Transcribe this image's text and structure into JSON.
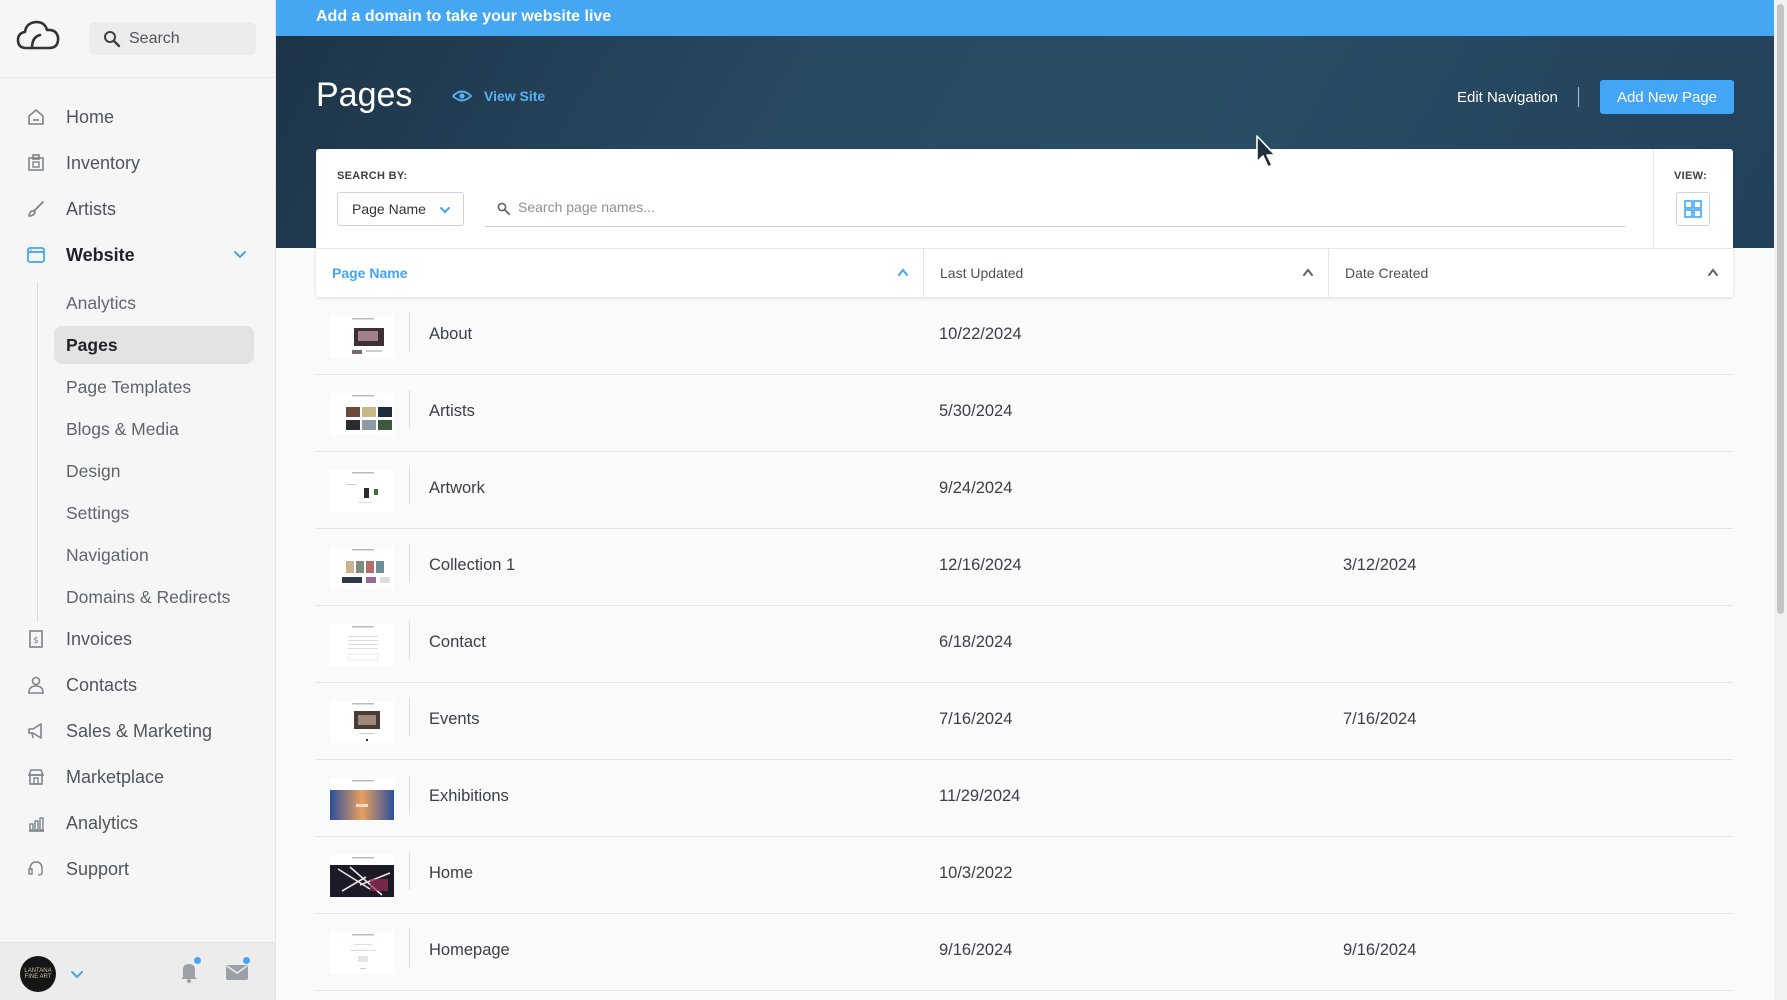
{
  "sidebar": {
    "search_label": "Search",
    "nav": [
      {
        "label": "Home",
        "icon": "home-icon"
      },
      {
        "label": "Inventory",
        "icon": "inventory-icon"
      },
      {
        "label": "Artists",
        "icon": "brush-icon"
      },
      {
        "label": "Website",
        "icon": "website-icon"
      }
    ],
    "website_sub": [
      {
        "label": "Analytics"
      },
      {
        "label": "Pages"
      },
      {
        "label": "Page Templates"
      },
      {
        "label": "Blogs & Media"
      },
      {
        "label": "Design"
      },
      {
        "label": "Settings"
      },
      {
        "label": "Navigation"
      },
      {
        "label": "Domains & Redirects"
      }
    ],
    "nav_after": [
      {
        "label": "Invoices",
        "icon": "invoice-icon"
      },
      {
        "label": "Contacts",
        "icon": "contacts-icon"
      },
      {
        "label": "Sales & Marketing",
        "icon": "megaphone-icon"
      },
      {
        "label": "Marketplace",
        "icon": "store-icon"
      },
      {
        "label": "Analytics",
        "icon": "chart-icon"
      },
      {
        "label": "Support",
        "icon": "support-icon"
      }
    ],
    "avatar_text": "LANTANA FINE ART"
  },
  "banner": {
    "text": "Add a domain to take your website live"
  },
  "header": {
    "title": "Pages",
    "view_site": "View Site",
    "edit_navigation": "Edit Navigation",
    "add_new_page": "Add New Page"
  },
  "filters": {
    "search_by_label": "SEARCH BY:",
    "search_by_value": "Page Name",
    "search_placeholder": "Search page names...",
    "view_label": "VIEW:"
  },
  "table": {
    "columns": [
      "Page Name",
      "Last Updated",
      "Date Created"
    ],
    "rows": [
      {
        "name": "About",
        "updated": "10/22/2024",
        "created": ""
      },
      {
        "name": "Artists",
        "updated": "5/30/2024",
        "created": ""
      },
      {
        "name": "Artwork",
        "updated": "9/24/2024",
        "created": ""
      },
      {
        "name": "Collection 1",
        "updated": "12/16/2024",
        "created": "3/12/2024"
      },
      {
        "name": "Contact",
        "updated": "6/18/2024",
        "created": ""
      },
      {
        "name": "Events",
        "updated": "7/16/2024",
        "created": "7/16/2024"
      },
      {
        "name": "Exhibitions",
        "updated": "11/29/2024",
        "created": ""
      },
      {
        "name": "Home",
        "updated": "10/3/2022",
        "created": ""
      },
      {
        "name": "Homepage",
        "updated": "9/16/2024",
        "created": "9/16/2024"
      }
    ]
  },
  "colors": {
    "accent": "#42a5f5",
    "banner": "#45a7f2",
    "hero": "#22405a"
  }
}
